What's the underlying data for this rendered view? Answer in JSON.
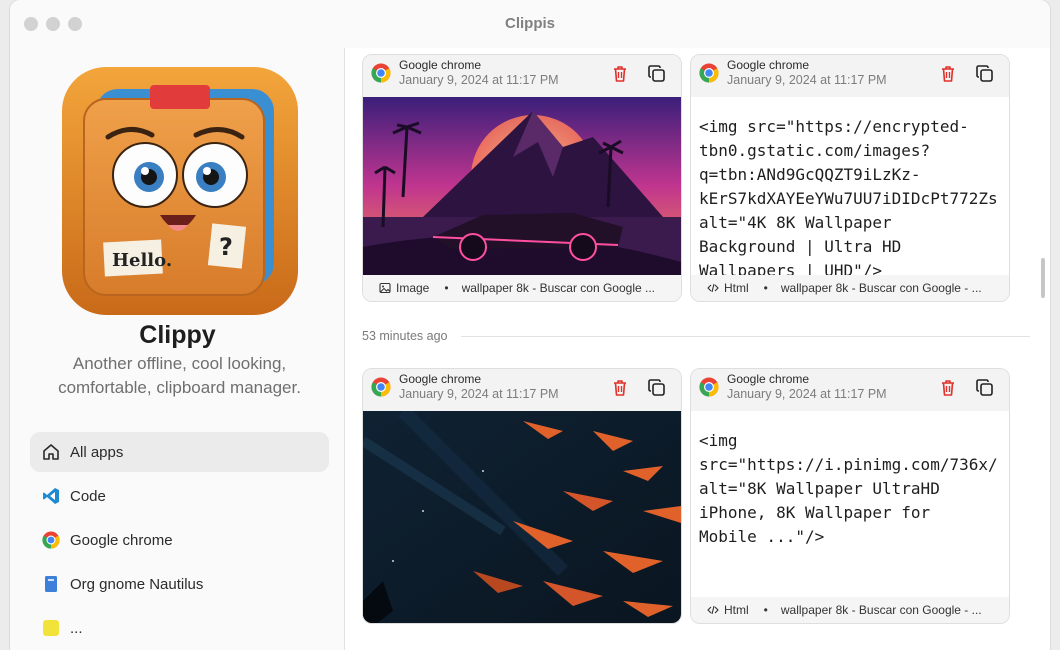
{
  "window": {
    "title": "Clippis"
  },
  "sidebar": {
    "app_name": "Clippy",
    "app_description": "Another offline, cool looking, comfortable, clipboard manager.",
    "logo_text": {
      "note": "Hello.",
      "question": "?"
    },
    "items": [
      {
        "label": "All apps",
        "icon": "home-icon",
        "active": true
      },
      {
        "label": "Code",
        "icon": "vscode-icon",
        "active": false
      },
      {
        "label": "Google chrome",
        "icon": "chrome-icon",
        "active": false
      },
      {
        "label": "Org gnome Nautilus",
        "icon": "nautilus-icon",
        "active": false
      },
      {
        "label": "...",
        "icon": "app-icon",
        "active": false
      }
    ]
  },
  "content": {
    "group_label": "53 minutes ago",
    "cards": [
      {
        "source": "Google chrome",
        "date": "January 9, 2024 at 11:17 PM",
        "kind": "Image",
        "title": "wallpaper 8k - Buscar con Google ..."
      },
      {
        "source": "Google chrome",
        "date": "January 9, 2024 at 11:17 PM",
        "kind": "Html",
        "title": "wallpaper 8k - Buscar con Google - ...",
        "code": "<img src=\"https://encrypted-\ntbn0.gstatic.com/images?\nq=tbn:ANd9GcQQZT9iLzKz-\nkErS7kdXAYEeYWu7UU7iDIDcPt772Zs\nalt=\"4K 8K Wallpaper\nBackground | Ultra HD\nWallpapers | UHD\"/>"
      },
      {
        "source": "Google chrome",
        "date": "January 9, 2024 at 11:17 PM",
        "kind": "Image",
        "title": ""
      },
      {
        "source": "Google chrome",
        "date": "January 9, 2024 at 11:17 PM",
        "kind": "Html",
        "title": "wallpaper 8k - Buscar con Google - ...",
        "code": "<img\nsrc=\"https://i.pinimg.com/736x/\nalt=\"8K Wallpaper UltraHD\niPhone, 8K Wallpaper for\nMobile ...\"/>"
      }
    ]
  },
  "colors": {
    "delete": "#e0312b",
    "accent_chrome_red": "#ea4335",
    "accent_chrome_yellow": "#fbbc05",
    "accent_chrome_green": "#34a853",
    "accent_chrome_blue": "#4285f4"
  }
}
